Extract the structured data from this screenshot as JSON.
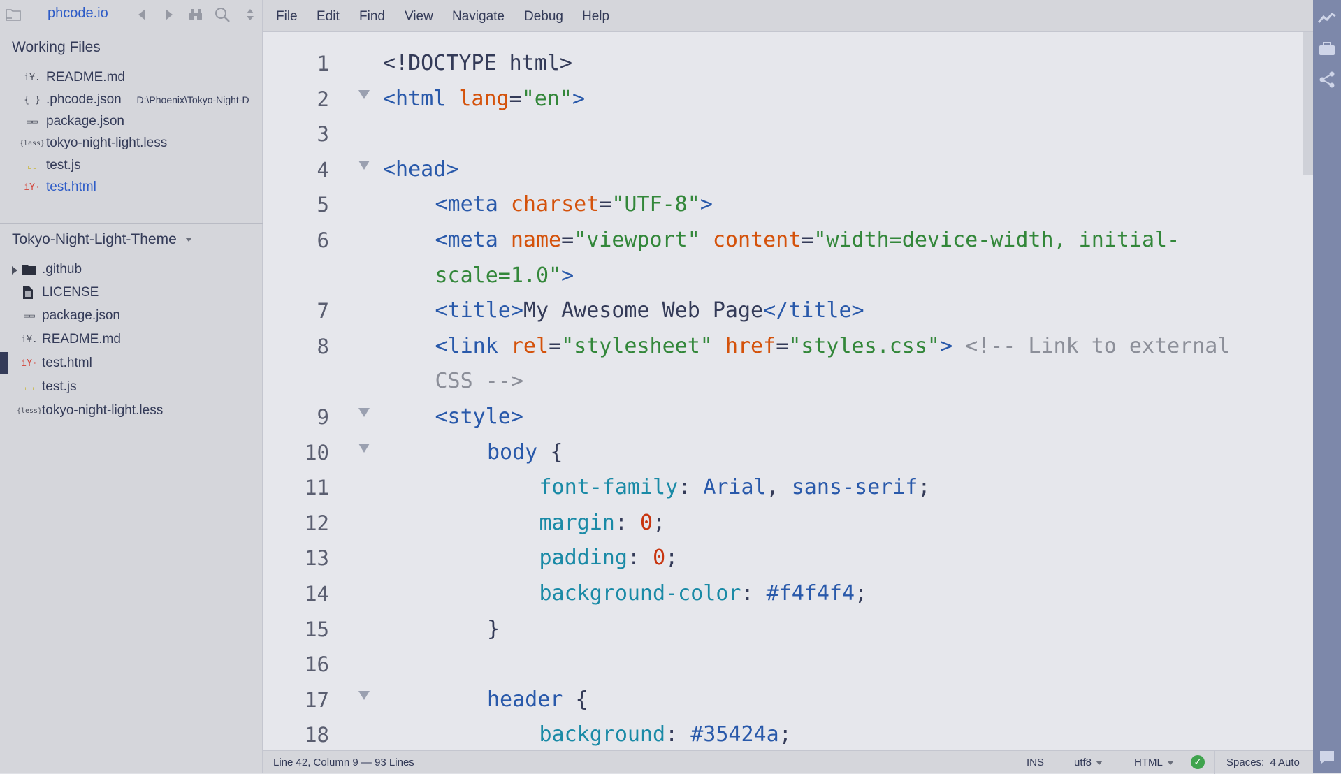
{
  "sidebar": {
    "project_title": "phcode.io",
    "working_files_title": "Working Files",
    "working_files": [
      {
        "icon": "markdown-icon",
        "glyph": "i¥.",
        "name": "README.md",
        "path": ""
      },
      {
        "icon": "json-braces-icon",
        "glyph": "{ }",
        "name": ".phcode.json",
        "path": " — D:\\Phoenix\\Tokyo-Night-D"
      },
      {
        "icon": "package-icon",
        "glyph": "▭▭",
        "name": "package.json",
        "path": ""
      },
      {
        "icon": "less-file-icon",
        "glyph": "{less}",
        "name": "tokyo-night-light.less",
        "path": ""
      },
      {
        "icon": "js-file-icon",
        "glyph": "⌞⌟",
        "name": "test.js",
        "path": ""
      },
      {
        "icon": "html-file-icon",
        "glyph": "iY·",
        "name": "test.html",
        "path": ""
      }
    ],
    "project_name": "Tokyo-Night-Light-Theme",
    "tree": [
      {
        "icon": "folder-icon",
        "name": ".github"
      },
      {
        "icon": "file-icon",
        "name": "LICENSE"
      },
      {
        "icon": "package-icon",
        "name": "package.json"
      },
      {
        "icon": "markdown-icon",
        "name": "README.md"
      },
      {
        "icon": "html-file-icon",
        "name": "test.html"
      },
      {
        "icon": "js-file-icon",
        "name": "test.js"
      },
      {
        "icon": "less-file-icon",
        "name": "tokyo-night-light.less"
      }
    ]
  },
  "menu": [
    "File",
    "Edit",
    "Find",
    "View",
    "Navigate",
    "Debug",
    "Help"
  ],
  "editor": {
    "lines": [
      {
        "n": "1",
        "fold": false,
        "indent": 0,
        "tokens": [
          [
            "plain",
            "<!DOCTYPE html>"
          ]
        ]
      },
      {
        "n": "2",
        "fold": true,
        "indent": 0,
        "tokens": [
          [
            "tag",
            "<html "
          ],
          [
            "attr",
            "lang"
          ],
          [
            "plain",
            "="
          ],
          [
            "str",
            "\"en\""
          ],
          [
            "tag",
            ">"
          ]
        ]
      },
      {
        "n": "3",
        "fold": false,
        "indent": 0,
        "tokens": []
      },
      {
        "n": "4",
        "fold": true,
        "indent": 0,
        "tokens": [
          [
            "tag",
            "<head>"
          ]
        ]
      },
      {
        "n": "5",
        "fold": false,
        "indent": 1,
        "tokens": [
          [
            "tag",
            "<meta "
          ],
          [
            "attr",
            "charset"
          ],
          [
            "plain",
            "="
          ],
          [
            "str",
            "\"UTF-8\""
          ],
          [
            "tag",
            ">"
          ]
        ]
      },
      {
        "n": "6",
        "fold": false,
        "indent": 1,
        "tokens": [
          [
            "tag",
            "<meta "
          ],
          [
            "attr",
            "name"
          ],
          [
            "plain",
            "="
          ],
          [
            "str",
            "\"viewport\" "
          ],
          [
            "attr",
            "content"
          ],
          [
            "plain",
            "="
          ],
          [
            "str",
            "\"width=device-width, initial-"
          ]
        ]
      },
      {
        "n": "",
        "fold": false,
        "indent": 1,
        "tokens": [
          [
            "str",
            "scale=1.0\""
          ],
          [
            "tag",
            ">"
          ]
        ]
      },
      {
        "n": "7",
        "fold": false,
        "indent": 1,
        "tokens": [
          [
            "tag",
            "<title>"
          ],
          [
            "plain",
            "My Awesome Web Page"
          ],
          [
            "tag",
            "</title>"
          ]
        ]
      },
      {
        "n": "8",
        "fold": false,
        "indent": 1,
        "tokens": [
          [
            "tag",
            "<link "
          ],
          [
            "attr",
            "rel"
          ],
          [
            "plain",
            "="
          ],
          [
            "str",
            "\"stylesheet\" "
          ],
          [
            "attr",
            "href"
          ],
          [
            "plain",
            "="
          ],
          [
            "str",
            "\"styles.css\""
          ],
          [
            "tag",
            "> "
          ],
          [
            "com",
            "<!-- Link to external"
          ]
        ]
      },
      {
        "n": "",
        "fold": false,
        "indent": 1,
        "tokens": [
          [
            "com",
            "CSS -->"
          ]
        ]
      },
      {
        "n": "9",
        "fold": true,
        "indent": 1,
        "tokens": [
          [
            "tag",
            "<style>"
          ]
        ]
      },
      {
        "n": "10",
        "fold": true,
        "indent": 2,
        "tokens": [
          [
            "sel",
            "body "
          ],
          [
            "plain",
            "{"
          ]
        ]
      },
      {
        "n": "11",
        "fold": false,
        "indent": 3,
        "tokens": [
          [
            "prop",
            "font-family"
          ],
          [
            "plain",
            ": "
          ],
          [
            "val",
            "Arial"
          ],
          [
            "plain",
            ", "
          ],
          [
            "val",
            "sans-serif"
          ],
          [
            "plain",
            ";"
          ]
        ]
      },
      {
        "n": "12",
        "fold": false,
        "indent": 3,
        "tokens": [
          [
            "prop",
            "margin"
          ],
          [
            "plain",
            ": "
          ],
          [
            "num",
            "0"
          ],
          [
            "plain",
            ";"
          ]
        ]
      },
      {
        "n": "13",
        "fold": false,
        "indent": 3,
        "tokens": [
          [
            "prop",
            "padding"
          ],
          [
            "plain",
            ": "
          ],
          [
            "num",
            "0"
          ],
          [
            "plain",
            ";"
          ]
        ]
      },
      {
        "n": "14",
        "fold": false,
        "indent": 3,
        "tokens": [
          [
            "prop",
            "background-color"
          ],
          [
            "plain",
            ": "
          ],
          [
            "val",
            "#f4f4f4"
          ],
          [
            "plain",
            ";"
          ]
        ]
      },
      {
        "n": "15",
        "fold": false,
        "indent": 2,
        "tokens": [
          [
            "plain",
            "}"
          ]
        ]
      },
      {
        "n": "16",
        "fold": false,
        "indent": 0,
        "tokens": []
      },
      {
        "n": "17",
        "fold": true,
        "indent": 2,
        "tokens": [
          [
            "sel",
            "header "
          ],
          [
            "plain",
            "{"
          ]
        ]
      },
      {
        "n": "18",
        "fold": false,
        "indent": 3,
        "tokens": [
          [
            "prop",
            "background"
          ],
          [
            "plain",
            ": "
          ],
          [
            "val",
            "#35424a"
          ],
          [
            "plain",
            ";"
          ]
        ]
      }
    ]
  },
  "status": {
    "cursor": "Line 42, Column 9 — 93 Lines",
    "mode": "INS",
    "encoding": "utf8",
    "language": "HTML",
    "spaces_label": "Spaces:",
    "spaces_value": "4",
    "auto": "Auto"
  },
  "colors": {
    "sidebar_bg": "#d5d6db",
    "editor_bg": "#e6e7ec",
    "right_toolbar": "#7d88aa",
    "project_title": "#2e5cc7",
    "active_file": "#2e5cc7"
  }
}
